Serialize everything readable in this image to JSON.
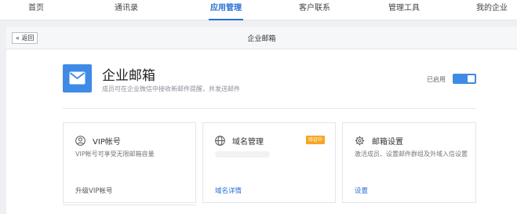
{
  "nav": {
    "items": [
      {
        "label": "首页"
      },
      {
        "label": "通讯录"
      },
      {
        "label": "应用管理"
      },
      {
        "label": "客户联系"
      },
      {
        "label": "管理工具"
      },
      {
        "label": "我的企业"
      }
    ],
    "active_index": 2
  },
  "subheader": {
    "back_label": "« 返回",
    "title": "企业邮箱"
  },
  "app": {
    "icon": "mail-icon",
    "title": "企业邮箱",
    "description": "成员可在企业微信中接收新邮件提醒，并发送邮件",
    "status_label": "已启用",
    "enabled": true
  },
  "cards": [
    {
      "icon": "user-circle-icon",
      "title": "VIP帐号",
      "description": "VIP帐号可享受无限邮箱容量",
      "link": "升级VIP帐号"
    },
    {
      "icon": "globe-icon",
      "title": "域名管理",
      "badge": "验证中",
      "link": "域名详情"
    },
    {
      "icon": "gear-icon",
      "title": "邮箱设置",
      "description": "激活成员、设置邮件群组及外域入信设置",
      "link": "设置"
    }
  ],
  "colors": {
    "accent": "#2a6fd6",
    "icon_bg": "#3e8be6",
    "badge": "#f5a623"
  }
}
